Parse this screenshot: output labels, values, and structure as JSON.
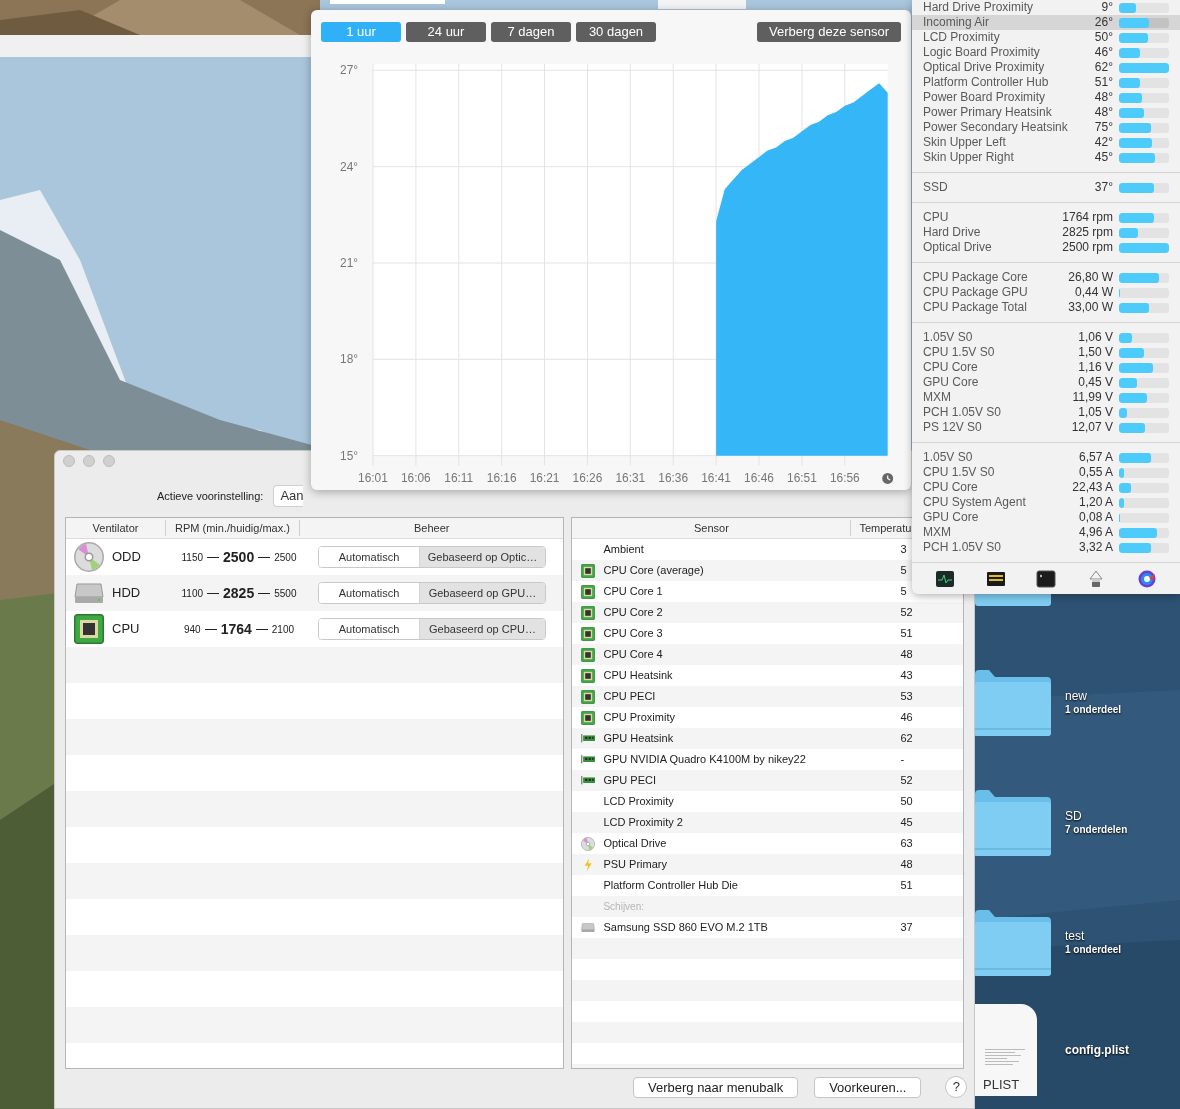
{
  "desktop": {
    "items": [
      {
        "kind": "folder",
        "name": "new",
        "detail": "1 onderdeel"
      },
      {
        "kind": "folder",
        "name": "SD",
        "detail": "7 onderdelen"
      },
      {
        "kind": "folder",
        "name": "test",
        "detail": "1 onderdeel"
      },
      {
        "kind": "file",
        "name": "config.plist",
        "badge": "PLIST"
      }
    ]
  },
  "main_window": {
    "preset_label": "Actieve voorinstelling:",
    "preset_value": "Aan",
    "fan_table": {
      "columns": [
        "Ventilator",
        "RPM (min./huidig/max.)",
        "Beheer"
      ],
      "rows": [
        {
          "kind": "disc",
          "name": "ODD",
          "min": "1150",
          "current": "2500",
          "max": "2500",
          "modes": [
            {
              "label": "Automatisch",
              "selected": false
            },
            {
              "label": "Gebaseerd op Optic…",
              "selected": true
            }
          ]
        },
        {
          "kind": "drive",
          "name": "HDD",
          "min": "1100",
          "current": "2825",
          "max": "5500",
          "modes": [
            {
              "label": "Automatisch",
              "selected": false
            },
            {
              "label": "Gebaseerd op GPU…",
              "selected": true
            }
          ]
        },
        {
          "kind": "chip",
          "name": "CPU",
          "min": "940",
          "current": "1764",
          "max": "2100",
          "modes": [
            {
              "label": "Automatisch",
              "selected": false
            },
            {
              "label": "Gebaseerd op CPU…",
              "selected": true
            }
          ]
        }
      ]
    },
    "sensor_table": {
      "columns": [
        "Sensor",
        "Temperatu"
      ],
      "rows": [
        {
          "kind": "plain",
          "name": "Ambient",
          "value": "3"
        },
        {
          "kind": "chip",
          "name": "CPU Core (average)",
          "value": "5"
        },
        {
          "kind": "chip",
          "name": "CPU Core 1",
          "value": "5"
        },
        {
          "kind": "chip",
          "name": "CPU Core 2",
          "value": "52"
        },
        {
          "kind": "chip",
          "name": "CPU Core 3",
          "value": "51"
        },
        {
          "kind": "chip",
          "name": "CPU Core 4",
          "value": "48"
        },
        {
          "kind": "chip",
          "name": "CPU Heatsink",
          "value": "43"
        },
        {
          "kind": "chip",
          "name": "CPU PECI",
          "value": "53"
        },
        {
          "kind": "chip",
          "name": "CPU Proximity",
          "value": "46"
        },
        {
          "kind": "gpu",
          "name": "GPU Heatsink",
          "value": "62"
        },
        {
          "kind": "gpu",
          "name": "GPU NVIDIA Quadro K4100M by nikey22",
          "value": "-"
        },
        {
          "kind": "gpu",
          "name": "GPU PECI",
          "value": "52"
        },
        {
          "kind": "plain",
          "name": "LCD Proximity",
          "value": "50"
        },
        {
          "kind": "plain",
          "name": "LCD Proximity 2",
          "value": "45"
        },
        {
          "kind": "disc",
          "name": "Optical Drive",
          "value": "63"
        },
        {
          "kind": "bolt",
          "name": "PSU Primary",
          "value": "48"
        },
        {
          "kind": "plain",
          "name": "Platform Controller Hub Die",
          "value": "51"
        },
        {
          "kind": "section",
          "name": "Schijven:"
        },
        {
          "kind": "drive",
          "name": "Samsung SSD 860 EVO M.2 1TB",
          "value": "37"
        }
      ]
    },
    "buttons": [
      "Verberg naar menubalk",
      "Voorkeuren..."
    ],
    "help": "?"
  },
  "chart_popup": {
    "ranges": [
      {
        "label": "1 uur",
        "selected": true
      },
      {
        "label": "24 uur",
        "selected": false
      },
      {
        "label": "7 dagen",
        "selected": false
      },
      {
        "label": "30 dagen",
        "selected": false
      }
    ],
    "hide_button": "Verberg deze sensor",
    "chart_data": {
      "type": "area",
      "ylim": [
        15,
        27.2
      ],
      "categories": [
        "16:01",
        null,
        null,
        null,
        null,
        "16:06",
        null,
        null,
        null,
        null,
        "16:11",
        null,
        null,
        null,
        null,
        "16:16",
        null,
        null,
        null,
        null,
        "16:21",
        null,
        null,
        null,
        null,
        "16:26",
        null,
        null,
        null,
        null,
        "16:31",
        null,
        null,
        null,
        null,
        "16:36",
        null,
        null,
        null,
        null,
        "16:41",
        null,
        null,
        null,
        null,
        "16:46",
        null,
        null,
        null,
        null,
        "16:51",
        null,
        null,
        null,
        null,
        "16:56",
        null,
        null,
        null,
        null,
        null
      ],
      "series": [
        {
          "color": "#35b6f6",
          "values": [
            null,
            null,
            null,
            null,
            null,
            null,
            null,
            null,
            null,
            null,
            null,
            null,
            null,
            null,
            null,
            null,
            null,
            null,
            null,
            null,
            null,
            null,
            null,
            null,
            null,
            null,
            null,
            null,
            null,
            null,
            null,
            null,
            null,
            null,
            null,
            null,
            null,
            null,
            null,
            null,
            22.3,
            23.3,
            23.6,
            23.9,
            24.1,
            24.3,
            24.5,
            24.6,
            24.8,
            24.9,
            25.1,
            25.3,
            25.4,
            25.6,
            25.7,
            25.9,
            26.0,
            26.2,
            26.4,
            26.6,
            26.3
          ]
        }
      ],
      "grid": true,
      "yticks": [
        {
          "value": 27,
          "label": "27°"
        },
        {
          "value": 24,
          "label": "24°"
        },
        {
          "value": 21,
          "label": "21°"
        },
        {
          "value": 18,
          "label": "18°"
        },
        {
          "value": 15,
          "label": "15°"
        }
      ]
    }
  },
  "menu": {
    "groups": [
      {
        "items": [
          {
            "label": "Hard Drive Proximity",
            "value": "9°",
            "level": 0.34,
            "selected": false
          },
          {
            "label": "Incoming Air",
            "value": "26°",
            "level": 0.6,
            "selected": true
          },
          {
            "label": "LCD Proximity",
            "value": "50°",
            "level": 0.58,
            "selected": false
          },
          {
            "label": "Logic Board Proximity",
            "value": "46°",
            "level": 0.42,
            "selected": false
          },
          {
            "label": "Optical Drive Proximity",
            "value": "62°",
            "level": 1,
            "selected": false
          },
          {
            "label": "Platform Controller Hub",
            "value": "51°",
            "level": 0.42,
            "selected": false
          },
          {
            "label": "Power Board Proximity",
            "value": "48°",
            "level": 0.46,
            "selected": false
          },
          {
            "label": "Power Primary Heatsink",
            "value": "48°",
            "level": 0.5,
            "selected": false
          },
          {
            "label": "Power Secondary Heatsink",
            "value": "75°",
            "level": 0.64,
            "selected": false
          },
          {
            "label": "Skin Upper Left",
            "value": "42°",
            "level": 0.66,
            "selected": false
          },
          {
            "label": "Skin Upper Right",
            "value": "45°",
            "level": 0.72,
            "selected": false
          }
        ]
      },
      {
        "items": [
          {
            "label": "SSD",
            "value": "37°",
            "level": 0.7,
            "selected": false
          }
        ]
      },
      {
        "items": [
          {
            "label": "CPU",
            "value": "1764 rpm",
            "level": 0.7,
            "selected": false
          },
          {
            "label": "Hard Drive",
            "value": "2825 rpm",
            "level": 0.38,
            "selected": false
          },
          {
            "label": "Optical Drive",
            "value": "2500 rpm",
            "level": 1,
            "selected": false
          }
        ]
      },
      {
        "items": [
          {
            "label": "CPU Package Core",
            "value": "26,80 W",
            "level": 0.8,
            "selected": false
          },
          {
            "label": "CPU Package GPU",
            "value": "0,44 W",
            "level": 0.02,
            "selected": false
          },
          {
            "label": "CPU Package Total",
            "value": "33,00 W",
            "level": 0.6,
            "selected": false
          }
        ]
      },
      {
        "items": [
          {
            "label": "1.05V S0",
            "value": "1,06 V",
            "level": 0.26,
            "selected": false
          },
          {
            "label": "CPU 1.5V S0",
            "value": "1,50 V",
            "level": 0.5,
            "selected": false
          },
          {
            "label": "CPU Core",
            "value": "1,16 V",
            "level": 0.68,
            "selected": false
          },
          {
            "label": "GPU Core",
            "value": "0,45 V",
            "level": 0.36,
            "selected": false
          },
          {
            "label": "MXM",
            "value": "11,99 V",
            "level": 0.56,
            "selected": false
          },
          {
            "label": "PCH 1.05V S0",
            "value": "1,05 V",
            "level": 0.16,
            "selected": false
          },
          {
            "label": "PS 12V S0",
            "value": "12,07 V",
            "level": 0.52,
            "selected": false
          }
        ]
      },
      {
        "items": [
          {
            "label": "1.05V S0",
            "value": "6,57 A",
            "level": 0.64,
            "selected": false
          },
          {
            "label": "CPU 1.5V S0",
            "value": "0,55 A",
            "level": 0.1,
            "selected": false
          },
          {
            "label": "CPU Core",
            "value": "22,43 A",
            "level": 0.24,
            "selected": false
          },
          {
            "label": "CPU System Agent",
            "value": "1,20 A",
            "level": 0.1,
            "selected": false
          },
          {
            "label": "GPU Core",
            "value": "0,08 A",
            "level": 0.02,
            "selected": false
          },
          {
            "label": "MXM",
            "value": "4,96 A",
            "level": 0.76,
            "selected": false
          },
          {
            "label": "PCH 1.05V S0",
            "value": "3,32 A",
            "level": 0.64,
            "selected": false
          }
        ]
      }
    ]
  }
}
